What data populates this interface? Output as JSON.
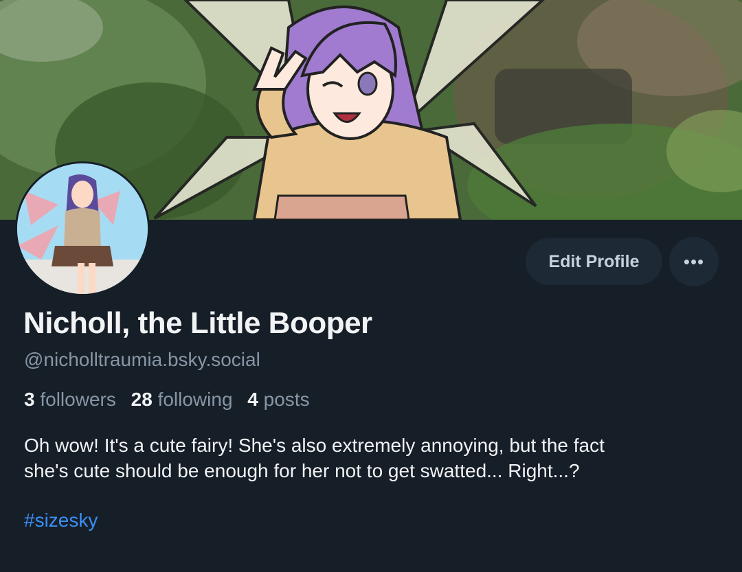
{
  "profile": {
    "display_name": "Nicholl, the Little Booper",
    "handle": "@nicholltraumia.bsky.social",
    "stats": {
      "followers_count": "3",
      "followers_label": "followers",
      "following_count": "28",
      "following_label": "following",
      "posts_count": "4",
      "posts_label": "posts"
    },
    "bio_line1": "Oh wow! It's a cute fairy! She's also extremely annoying, but the fact",
    "bio_line2": "she's cute should be enough for her not to get swatted... Right...?",
    "hashtag": "#sizesky"
  },
  "actions": {
    "edit_profile_label": "Edit Profile",
    "more_label": "•••",
    "more_icon": "more-horizontal-icon"
  },
  "colors": {
    "background": "#161e27",
    "button_bg": "#1e2936",
    "muted_text": "#8796a6",
    "link": "#3a8ff5"
  }
}
